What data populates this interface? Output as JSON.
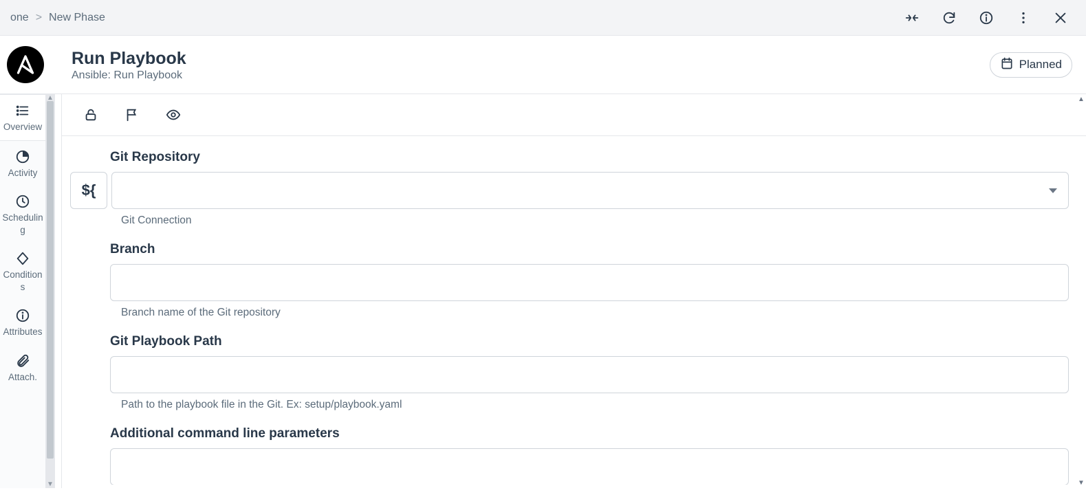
{
  "breadcrumb": {
    "parent": "one",
    "current": "New Phase"
  },
  "header": {
    "title": "Run Playbook",
    "subtitle": "Ansible: Run Playbook",
    "status": "Planned"
  },
  "sidebar": {
    "items": [
      {
        "label": "Overview"
      },
      {
        "label": "Activity"
      },
      {
        "label": "Scheduling"
      },
      {
        "label": "Conditions"
      },
      {
        "label": "Attributes"
      },
      {
        "label": "Attach."
      }
    ]
  },
  "form": {
    "var_btn": "${",
    "git_repo": {
      "label": "Git Repository",
      "value": "",
      "help": "Git Connection"
    },
    "branch": {
      "label": "Branch",
      "value": "",
      "help": "Branch name of the Git repository"
    },
    "path": {
      "label": "Git Playbook Path",
      "value": "",
      "help": "Path to the playbook file in the Git. Ex: setup/playbook.yaml"
    },
    "params": {
      "label": "Additional command line parameters",
      "value": ""
    }
  }
}
